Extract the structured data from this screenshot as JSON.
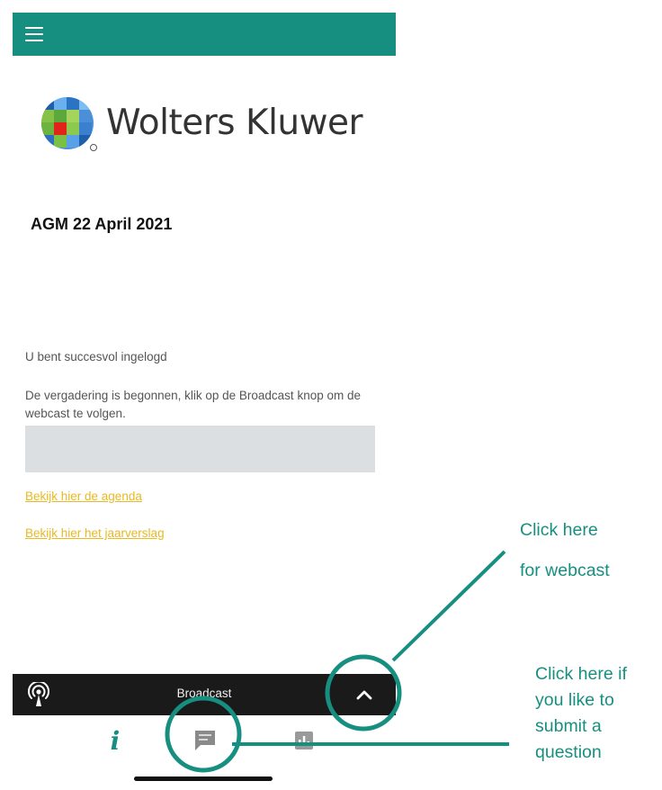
{
  "app": {
    "brand": "Wolters Kluwer",
    "meeting_title": "AGM 22 April 2021"
  },
  "content": {
    "login_message": "U bent succesvol ingelogd",
    "meeting_started_message": "De vergadering is begonnen, klik op de Broadcast knop om de webcast te volgen.",
    "agenda_link": "Bekijk hier de agenda",
    "annual_report_link": "Bekijk hier het jaarverslag"
  },
  "broadcast": {
    "label": "Broadcast"
  },
  "tabs": {
    "info_glyph": "i",
    "items": [
      "info-icon",
      "chat-icon",
      "poll-icon"
    ]
  },
  "annotations": {
    "webcast_line1": "Click here",
    "webcast_line2": "for webcast",
    "question_lines": [
      "Click here if",
      "you like to",
      "submit a",
      "question"
    ]
  },
  "colors": {
    "accent": "#178f80",
    "link": "#e8b922",
    "bar": "#1a1a1a",
    "placeholder": "#dcdfe1"
  }
}
